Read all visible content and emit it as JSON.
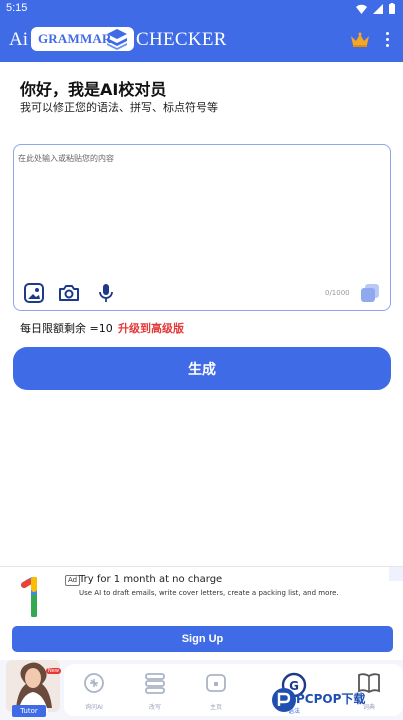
{
  "status_bar": {
    "time": "5:15"
  },
  "app_bar": {
    "logo_ai": "Ai",
    "logo_grammar": "GRAMMAR",
    "logo_checker": "CHECKER",
    "crown_icon": "crown-icon",
    "menu_icon": "more-vert-icon"
  },
  "intro": {
    "heading": "你好，我是AI校对员",
    "subheading": "我可以修正您的语法、拼写、标点符号等"
  },
  "editor": {
    "placeholder": "在此处输入或粘贴您的内容",
    "value": "",
    "counter": "0/1000",
    "tools": [
      "image-icon",
      "camera-icon",
      "mic-icon"
    ],
    "copy_icon": "copy-icon"
  },
  "quota": {
    "text": "每日限额剩余 =10",
    "upgrade_label": "升级到高级版"
  },
  "generate_label": "生成",
  "ad": {
    "badge": "Ad",
    "title": "Try for 1 month at no charge",
    "description": "Use AI to draft emails, write cover letters, create a packing list, and more.",
    "cta": "Sign Up"
  },
  "bottom_nav": {
    "tutor_label": "Tutor",
    "tutor_badge": "New",
    "items": [
      {
        "label": "询问AI",
        "icon": "ai-brain-icon"
      },
      {
        "label": "改写",
        "icon": "rewrite-icon"
      },
      {
        "label": "主页",
        "icon": "home-icon"
      },
      {
        "label": "语法",
        "icon": "grammar-icon"
      },
      {
        "label": "词典",
        "icon": "dictionary-icon"
      }
    ]
  },
  "watermark": "PCPOP下载",
  "colors": {
    "primary": "#3f6be6",
    "upgrade": "#e43b3b",
    "editor_border": "#8fa6ec"
  }
}
